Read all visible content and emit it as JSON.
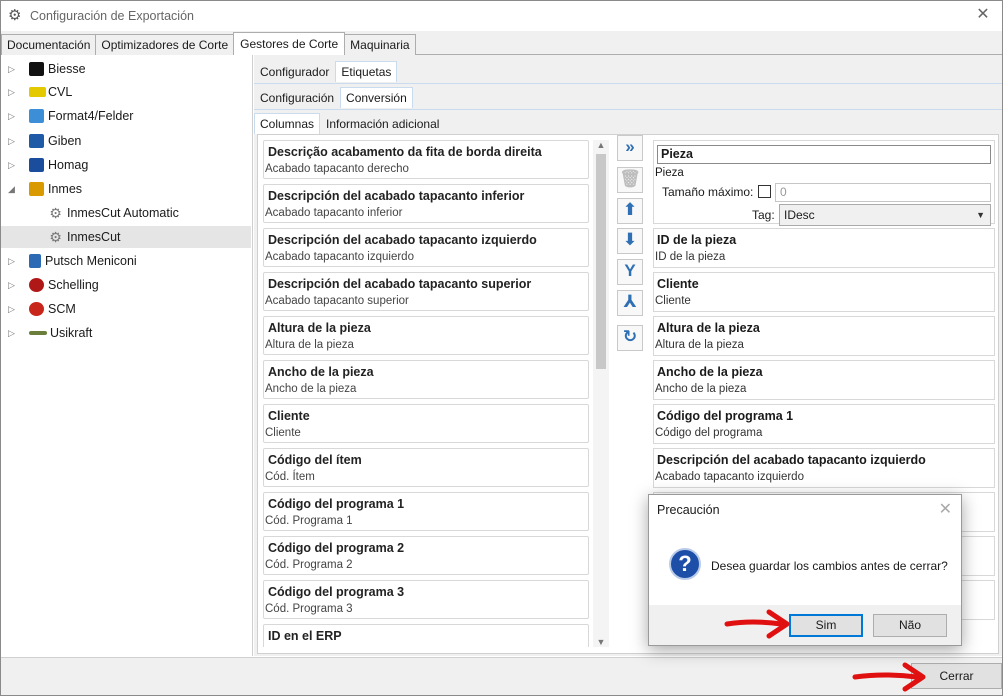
{
  "window": {
    "title": "Configuración de Exportación"
  },
  "top_tabs": [
    "Documentación",
    "Optimizadores de Corte",
    "Gestores de Corte",
    "Maquinaria"
  ],
  "tree": [
    {
      "label": "Biesse",
      "logo_color": "#111111"
    },
    {
      "label": "CVL",
      "logo_color": "#e4c800"
    },
    {
      "label": "Format4/Felder",
      "logo_color": "#3c8fd6"
    },
    {
      "label": "Giben",
      "logo_color": "#1f5aa6"
    },
    {
      "label": "Homag",
      "logo_color": "#1a4e9c"
    },
    {
      "label": "Inmes",
      "logo_color": "#d89a00"
    },
    {
      "label": "InmesCut Automatic"
    },
    {
      "label": "InmesCut"
    },
    {
      "label": "Putsch Meniconi",
      "logo_color": "#2c6bb4"
    },
    {
      "label": "Schelling",
      "logo_color": "#b01818"
    },
    {
      "label": "SCM",
      "logo_color": "#c8261b"
    },
    {
      "label": "Usikraft",
      "logo_color": "#6a7f3a"
    }
  ],
  "subtabs1": [
    "Configurador",
    "Etiquetas"
  ],
  "subtabs2": [
    "Configuración",
    "Conversión"
  ],
  "subtabs3": [
    "Columnas",
    "Información adicional"
  ],
  "left_fields": [
    {
      "title": "Descrição acabamento da fita de borda direita",
      "sub": "Acabado tapacanto derecho"
    },
    {
      "title": "Descripción del acabado tapacanto inferior",
      "sub": "Acabado tapacanto inferior"
    },
    {
      "title": "Descripción del acabado tapacanto izquierdo",
      "sub": "Acabado tapacanto izquierdo"
    },
    {
      "title": "Descripción del acabado tapacanto superior",
      "sub": "Acabado tapacanto superior"
    },
    {
      "title": "Altura de la pieza",
      "sub": "Altura de la pieza"
    },
    {
      "title": "Ancho de la pieza",
      "sub": "Ancho de la pieza"
    },
    {
      "title": "Cliente",
      "sub": "Cliente"
    },
    {
      "title": "Código del ítem",
      "sub": "Cód. Ítem"
    },
    {
      "title": "Código del programa 1",
      "sub": "Cód. Programa 1"
    },
    {
      "title": "Código del programa 2",
      "sub": "Cód. Programa 2"
    },
    {
      "title": "Código del programa 3",
      "sub": "Cód. Programa 3"
    },
    {
      "title": "ID en el ERP",
      "sub": ""
    }
  ],
  "editor": {
    "name": "Pieza",
    "sub": "Pieza",
    "max_label": "Tamaño máximo:",
    "max_value": "0",
    "tag_label": "Tag:",
    "tag_value": "IDesc"
  },
  "right_fields": [
    {
      "title": "ID de la pieza",
      "sub": "ID de la pieza"
    },
    {
      "title": "Cliente",
      "sub": "Cliente"
    },
    {
      "title": "Altura de la pieza",
      "sub": "Altura de la pieza"
    },
    {
      "title": "Ancho de la pieza",
      "sub": "Ancho de la pieza"
    },
    {
      "title": "Código del programa 1",
      "sub": "Código del programa"
    },
    {
      "title": "Descripción del acabado tapacanto izquierdo",
      "sub": "Acabado tapacanto izquierdo"
    },
    {
      "title": "",
      "sub": ""
    },
    {
      "title": "",
      "sub": ""
    },
    {
      "title": "",
      "sub": ""
    }
  ],
  "toolbar_icons": [
    "add-all-icon",
    "delete-icon",
    "move-up-icon",
    "move-down-icon",
    "merge-icon",
    "split-icon",
    "refresh-icon"
  ],
  "footer": {
    "close_label": "Cerrar"
  },
  "dialog": {
    "title": "Precaución",
    "message": "Desea guardar los cambios antes de cerrar?",
    "yes": "Sim",
    "no": "Não"
  }
}
